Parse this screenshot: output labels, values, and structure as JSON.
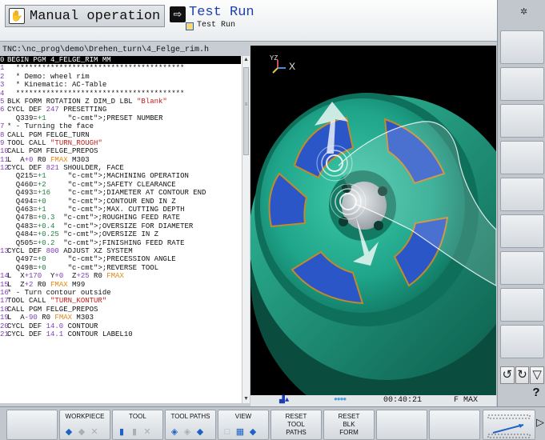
{
  "header": {
    "mode_label": "Manual operation",
    "mode_icon": "hand-icon",
    "sub_mode_label": "Test Run",
    "sub_mode_icon": "test-run-icon",
    "sub_mode_file": "Test Run"
  },
  "program": {
    "path": "TNC:\\nc_prog\\demo\\Drehen_turn\\4_Felge_rim.h",
    "lines": [
      {
        "num": "0",
        "text": "BEGIN PGM 4_FELGE_RIM MM",
        "selected": true
      },
      {
        "num": "1",
        "text": "  ***************************************"
      },
      {
        "num": "2",
        "text": "  * Demo: wheel rim"
      },
      {
        "num": "3",
        "text": "  * Kinematic: AC-Table"
      },
      {
        "num": "4",
        "text": "  ***************************************"
      },
      {
        "num": "5",
        "text": "BLK FORM ROTATION Z DIM_D LBL \"Blank\""
      },
      {
        "num": "6",
        "text": "CYCL DEF 247 PRESETTING"
      },
      {
        "num": "",
        "text": "  Q339=+1     ;PRESET NUMBER"
      },
      {
        "num": "7",
        "text": "* - Turning the face"
      },
      {
        "num": "8",
        "text": "CALL PGM FELGE_TURN"
      },
      {
        "num": "9",
        "text": "TOOL CALL \"TURN_ROUGH\""
      },
      {
        "num": "10",
        "text": "CALL PGM FELGE_PREPOS"
      },
      {
        "num": "11",
        "text": "L  A+0 R0 FMAX M303"
      },
      {
        "num": "12",
        "text": "CYCL DEF 821 SHOULDER, FACE"
      },
      {
        "num": "",
        "text": "  Q215=+1     ;MACHINING OPERATION"
      },
      {
        "num": "",
        "text": "  Q460=+2     ;SAFETY CLEARANCE"
      },
      {
        "num": "",
        "text": "  Q493=+16    ;DIAMETER AT CONTOUR END"
      },
      {
        "num": "",
        "text": "  Q494=+0     ;CONTOUR END IN Z"
      },
      {
        "num": "",
        "text": "  Q463=+1     ;MAX. CUTTING DEPTH"
      },
      {
        "num": "",
        "text": "  Q478=+0.3  ;ROUGHING FEED RATE"
      },
      {
        "num": "",
        "text": "  Q483=+0.4  ;OVERSIZE FOR DIAMETER"
      },
      {
        "num": "",
        "text": "  Q484=+0.25 ;OVERSIZE IN Z"
      },
      {
        "num": "",
        "text": "  Q505=+0.2  ;FINISHING FEED RATE"
      },
      {
        "num": "13",
        "text": "CYCL DEF 800 ADJUST XZ SYSTEM"
      },
      {
        "num": "",
        "text": "  Q497=+0     ;PRECESSION ANGLE"
      },
      {
        "num": "",
        "text": "  Q498=+0     ;REVERSE TOOL"
      },
      {
        "num": "14",
        "text": "L  X+170  Y+0  Z+25 R0 FMAX"
      },
      {
        "num": "15",
        "text": "L  Z+2 R0 FMAX M99"
      },
      {
        "num": "16",
        "text": "* - Turn contour outside"
      },
      {
        "num": "17",
        "text": "TOOL CALL \"TURN_KONTUR\""
      },
      {
        "num": "18",
        "text": "CALL PGM FELGE_PREPOS"
      },
      {
        "num": "19",
        "text": "L  A-90 R0 FMAX M303"
      },
      {
        "num": "20",
        "text": "CYCL DEF 14.0 CONTOUR"
      },
      {
        "num": "21",
        "text": "CYCL DEF 14.1 CONTOUR LABEL10"
      }
    ]
  },
  "graphic": {
    "axis_label": "X",
    "axis_label_small": "YZ",
    "time": "00:40:21",
    "feed": "F MAX",
    "colors": {
      "rim": "#1fa58a",
      "rim_dark": "#0d6b58",
      "pocket": "#2a56c8",
      "hub": "#b9c1c6",
      "background": "#000000"
    }
  },
  "softkeys": {
    "workpiece": "WORKPIECE",
    "tool": "TOOL",
    "tool_paths": "TOOL PATHS",
    "view": "VIEW",
    "reset_tool_paths": "RESET\nTOOL\nPATHS",
    "reset_blk_form": "RESET\nBLK\nFORM"
  },
  "right_panel": {
    "help": "?"
  }
}
